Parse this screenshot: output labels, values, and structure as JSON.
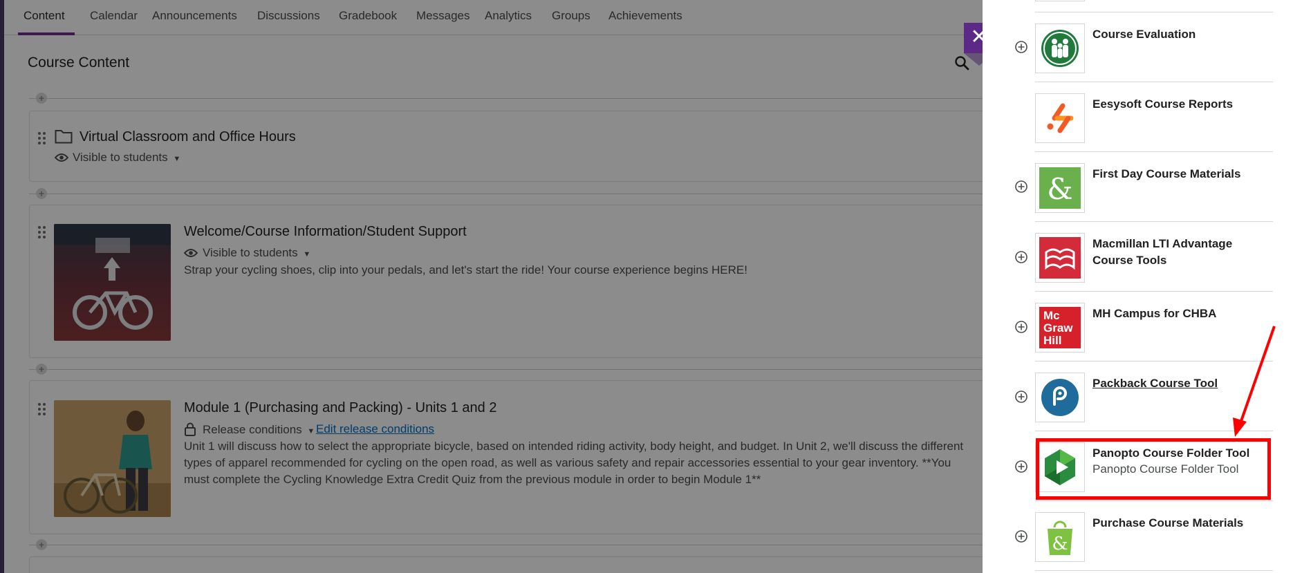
{
  "nav": {
    "tabs": [
      {
        "label": "Content"
      },
      {
        "label": "Calendar"
      },
      {
        "label": "Announcements"
      },
      {
        "label": "Discussions"
      },
      {
        "label": "Gradebook"
      },
      {
        "label": "Messages"
      },
      {
        "label": "Analytics"
      },
      {
        "label": "Groups"
      },
      {
        "label": "Achievements"
      }
    ]
  },
  "content": {
    "title": "Course Content",
    "items": [
      {
        "title": "Virtual Classroom and Office Hours",
        "visibility": "Visible to students"
      },
      {
        "title": "Welcome/Course Information/Student Support",
        "visibility": "Visible to students",
        "description": "Strap your cycling shoes, clip into your pedals, and let's start the ride! Your course experience begins HERE!"
      },
      {
        "title": "Module 1 (Purchasing and Packing) - Units 1 and 2",
        "release": "Release conditions",
        "edit_link": "Edit release conditions",
        "description": "Unit 1 will discuss how to select the appropriate bicycle, based on intended riding activity, body height, and budget. In Unit 2, we'll discuss the different types of apparel recommended for cycling on the open road, as well as various safety and repair accessories essential to your gear inventory. **You must complete the Cycling Knowledge Extra Credit Quiz from the previous module in order to begin Module 1**"
      }
    ]
  },
  "panel": {
    "close_symbol": "✕",
    "tools": [
      {
        "name": "Course Evaluation"
      },
      {
        "name": "Eesysoft Course Reports"
      },
      {
        "name": "First Day Course Materials"
      },
      {
        "name": "Macmillan LTI Advantage Course Tools"
      },
      {
        "name": "MH Campus for CHBA",
        "logo_text": [
          "Mc",
          "Graw",
          "Hill"
        ]
      },
      {
        "name": "Packback Course Tool"
      },
      {
        "name": "Panopto Course Folder Tool",
        "subtitle": "Panopto Course Folder Tool"
      },
      {
        "name": "Purchase Course Materials"
      }
    ]
  },
  "colors": {
    "accent": "#6e2d91",
    "close_button": "#5c2a86",
    "annotation": "#ff0000",
    "link": "#006fbf"
  }
}
